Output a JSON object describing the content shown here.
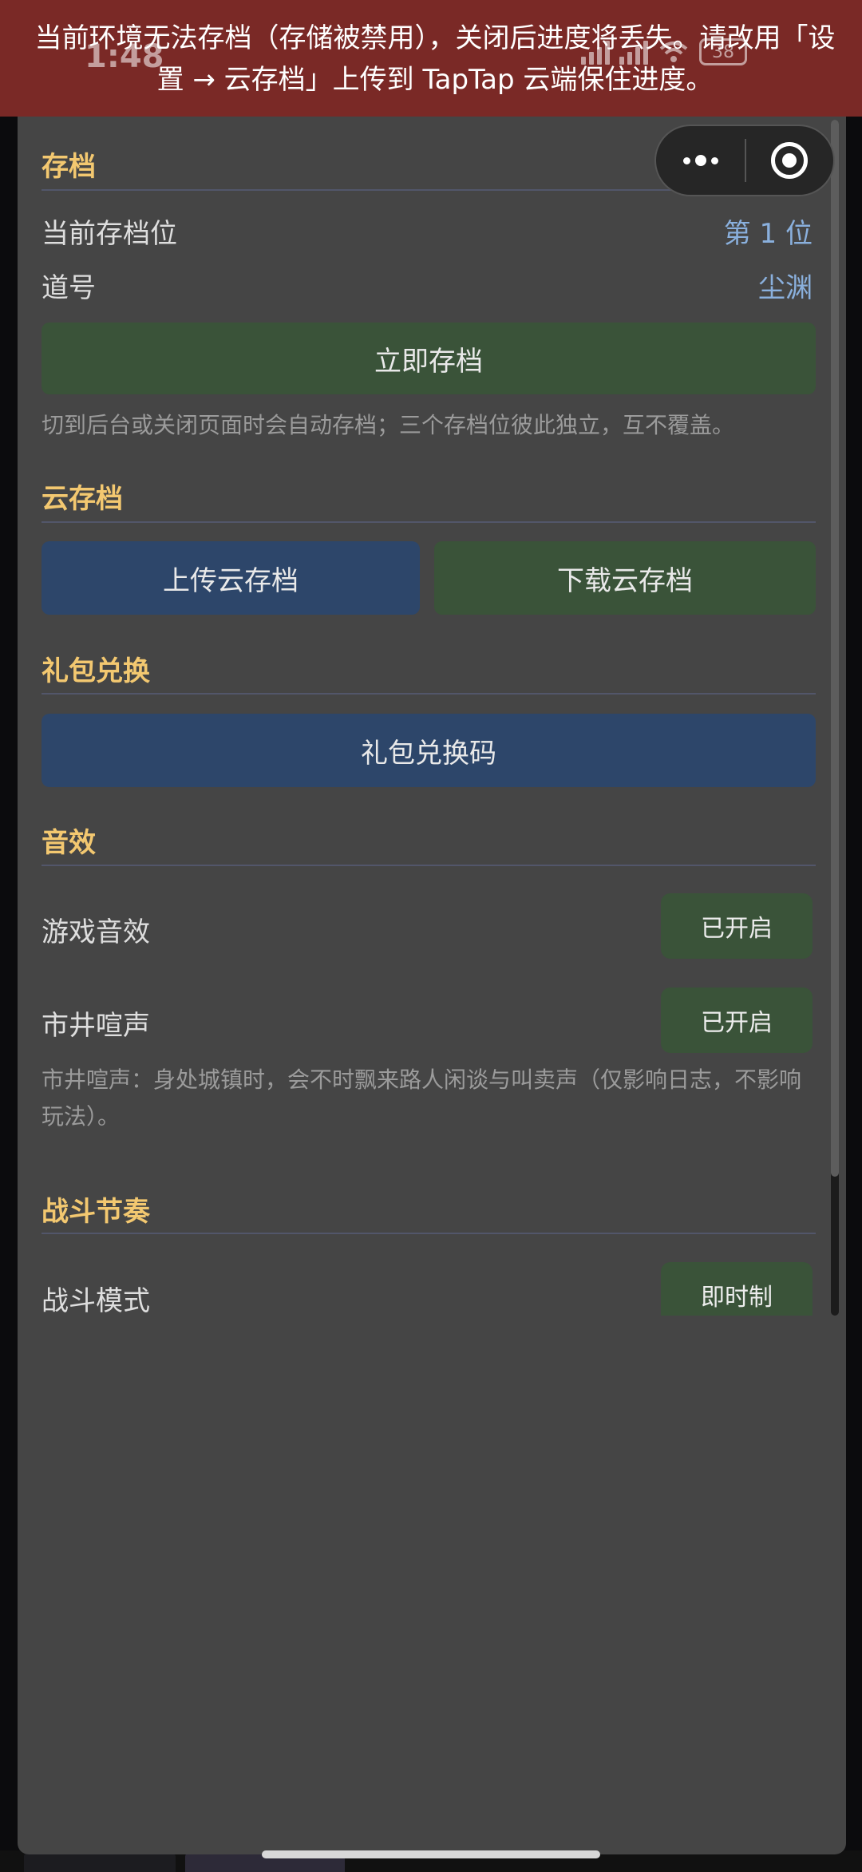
{
  "banner": {
    "text": "当前环境无法存档（存储被禁用），关闭后进度将丢失。请改用「设置 → 云存档」上传到 TapTap 云端保住进度。"
  },
  "status_bar": {
    "time": "1:48",
    "battery": "38"
  },
  "save": {
    "title": "存档",
    "slot_label": "当前存档位",
    "slot_value": "第 1 位",
    "name_label": "道号",
    "name_value": "尘渊",
    "save_button": "立即存档",
    "hint": "切到后台或关闭页面时会自动存档；三个存档位彼此独立，互不覆盖。"
  },
  "cloud": {
    "title": "云存档",
    "upload_button": "上传云存档",
    "download_button": "下载云存档"
  },
  "gift": {
    "title": "礼包兑换",
    "redeem_button": "礼包兑换码"
  },
  "sound": {
    "title": "音效",
    "game_sound_label": "游戏音效",
    "game_sound_state": "已开启",
    "street_noise_label": "市井喧声",
    "street_noise_state": "已开启",
    "hint": "市井喧声：身处城镇时，会不时飘来路人闲谈与叫卖声（仅影响日志，不影响玩法）。"
  },
  "battle": {
    "title": "战斗节奏",
    "mode_label": "战斗模式",
    "mode_value": "即时制"
  },
  "colors": {
    "banner_bg": "#7a2926",
    "panel_bg": "#454545",
    "section_title": "#f3c870",
    "value_blue": "#8ab0dd",
    "button_green": "#3a5339",
    "button_blue": "#2d466a"
  },
  "icons": {
    "capsule_more": "more-dots-icon",
    "capsule_close": "close-target-icon"
  }
}
